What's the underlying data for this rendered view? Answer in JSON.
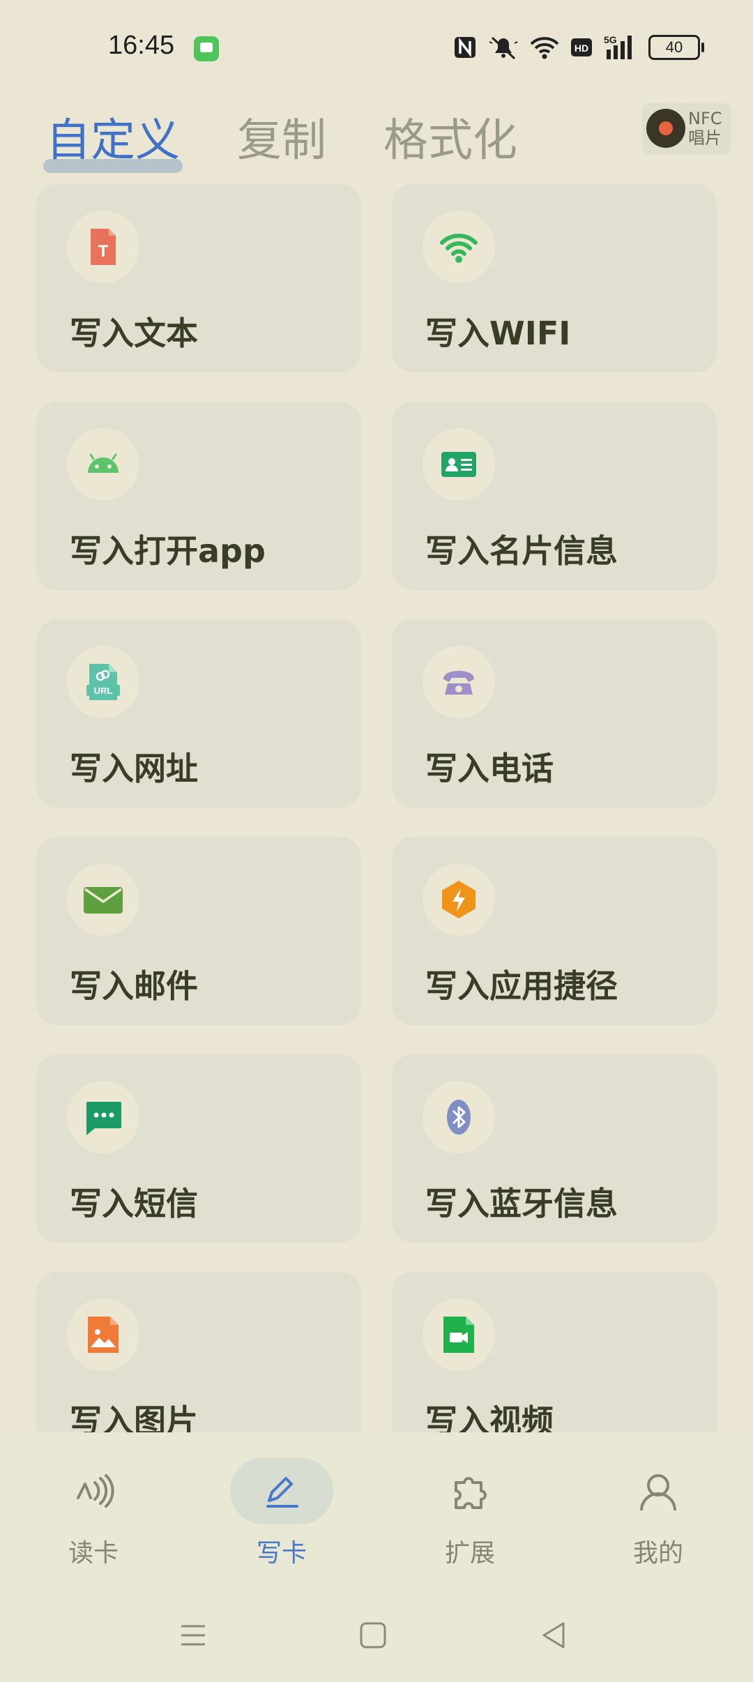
{
  "status_bar": {
    "time": "16:45",
    "battery": "40",
    "icons": [
      "message-app-icon",
      "nfc-icon",
      "mute-icon",
      "wifi-icon",
      "hd-icon",
      "signal-5g-icon",
      "battery-icon"
    ]
  },
  "tabs": [
    {
      "label": "自定义",
      "active": true
    },
    {
      "label": "复制",
      "active": false
    },
    {
      "label": "格式化",
      "active": false
    }
  ],
  "nfc_badge": {
    "line1": "NFC",
    "line2": "唱片"
  },
  "cards": [
    {
      "label": "写入文本",
      "icon": "text-file-icon",
      "color": "#e8725a"
    },
    {
      "label": "写入WIFI",
      "icon": "wifi-icon",
      "color": "#35b85c"
    },
    {
      "label": "写入打开app",
      "icon": "android-icon",
      "color": "#5ec46b"
    },
    {
      "label": "写入名片信息",
      "icon": "contact-card-icon",
      "color": "#22a564"
    },
    {
      "label": "写入网址",
      "icon": "url-icon",
      "color": "#5cc3a8"
    },
    {
      "label": "写入电话",
      "icon": "phone-icon",
      "color": "#9f8fc8"
    },
    {
      "label": "写入邮件",
      "icon": "mail-icon",
      "color": "#5ea040"
    },
    {
      "label": "写入应用捷径",
      "icon": "shortcut-bolt-icon",
      "color": "#f09319"
    },
    {
      "label": "写入短信",
      "icon": "sms-icon",
      "color": "#1a9a66"
    },
    {
      "label": "写入蓝牙信息",
      "icon": "bluetooth-icon",
      "color": "#7f8fc4"
    },
    {
      "label": "写入图片",
      "icon": "image-file-icon",
      "color": "#f07a38"
    },
    {
      "label": "写入视频",
      "icon": "video-file-icon",
      "color": "#1fb24a"
    }
  ],
  "bottom_nav": [
    {
      "label": "读卡",
      "icon": "nfc-read-icon",
      "active": false
    },
    {
      "label": "写卡",
      "icon": "pen-icon",
      "active": true
    },
    {
      "label": "扩展",
      "icon": "puzzle-icon",
      "active": false
    },
    {
      "label": "我的",
      "icon": "profile-icon",
      "active": false
    }
  ],
  "system_nav": [
    "menu-icon",
    "home-icon",
    "back-icon"
  ]
}
